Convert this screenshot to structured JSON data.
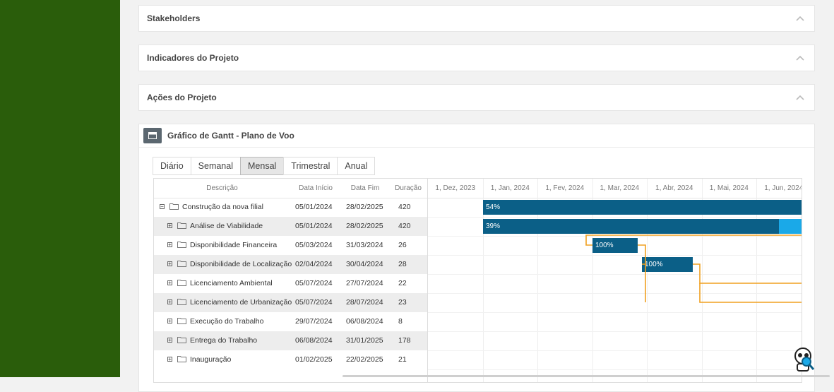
{
  "panels": [
    {
      "title": "Stakeholders"
    },
    {
      "title": "Indicadores do Projeto"
    },
    {
      "title": "Ações do Projeto"
    }
  ],
  "gantt": {
    "title": "Gráfico de Gantt - Plano de Voo",
    "tabs": [
      "Diário",
      "Semanal",
      "Mensal",
      "Trimestral",
      "Anual"
    ],
    "active_tab": "Mensal",
    "columns": {
      "description": "Descrição",
      "start": "Data Início",
      "end": "Data Fim",
      "duration": "Duração"
    },
    "months": [
      "1, Dez, 2023",
      "1, Jan, 2024",
      "1, Fev, 2024",
      "1, Mar, 2024",
      "1, Abr, 2024",
      "1, Mai, 2024",
      "1, Jun, 2024"
    ],
    "tasks": [
      {
        "name": "Construção da nova filial",
        "start": "05/01/2024",
        "end": "28/02/2025",
        "duration": "420",
        "toggle": "−",
        "level": 0,
        "progress": "54%"
      },
      {
        "name": "Análise de Viabilidade",
        "start": "05/01/2024",
        "end": "28/02/2025",
        "duration": "420",
        "toggle": "+",
        "level": 1,
        "progress": "39%"
      },
      {
        "name": "Disponibilidade Financeira",
        "start": "05/03/2024",
        "end": "31/03/2024",
        "duration": "26",
        "toggle": "+",
        "level": 1,
        "progress": "100%"
      },
      {
        "name": "Disponibilidade de Localização",
        "start": "02/04/2024",
        "end": "30/04/2024",
        "duration": "28",
        "toggle": "+",
        "level": 1,
        "progress": "100%"
      },
      {
        "name": "Licenciamento Ambiental",
        "start": "05/07/2024",
        "end": "27/07/2024",
        "duration": "22",
        "toggle": "+",
        "level": 1,
        "progress": ""
      },
      {
        "name": "Licenciamento de Urbanização",
        "start": "05/07/2024",
        "end": "28/07/2024",
        "duration": "23",
        "toggle": "+",
        "level": 1,
        "progress": ""
      },
      {
        "name": "Execução do Trabalho",
        "start": "29/07/2024",
        "end": "06/08/2024",
        "duration": "8",
        "toggle": "+",
        "level": 1,
        "progress": ""
      },
      {
        "name": "Entrega do Trabalho",
        "start": "06/08/2024",
        "end": "31/01/2025",
        "duration": "178",
        "toggle": "+",
        "level": 1,
        "progress": ""
      },
      {
        "name": "Inauguração",
        "start": "01/02/2025",
        "end": "22/02/2025",
        "duration": "21",
        "toggle": "+",
        "level": 1,
        "progress": ""
      }
    ]
  },
  "colors": {
    "sidebar": "#2a5d0b",
    "bar": "#0b5f87",
    "bar_progress": "#1aa9e8",
    "link": "#f0a020"
  }
}
